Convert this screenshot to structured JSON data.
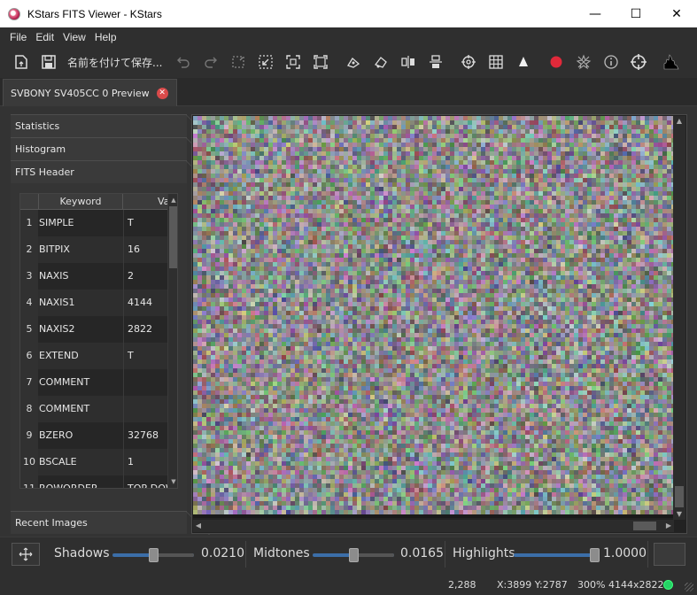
{
  "window": {
    "title": "KStars FITS Viewer - KStars",
    "minimize_glyph": "—",
    "maximize_glyph": "☐",
    "close_glyph": "✕"
  },
  "menu": [
    "File",
    "Edit",
    "View",
    "Help"
  ],
  "toolbar": {
    "save_as_label": "名前を付けて保存...",
    "icons": [
      "open-file-icon",
      "save-icon",
      "undo-icon",
      "redo-icon",
      "crop-icon",
      "zoom-fit-icon",
      "zoom-in-icon",
      "zoom-out-icon",
      "mark-stars-icon",
      "histogram-icon",
      "flip-horizontal-icon",
      "flip-vertical-icon",
      "crosshair-icon",
      "pixel-grid-icon",
      "triangle-icon",
      "record-icon",
      "star-filter-icon",
      "info-icon",
      "target-icon",
      "histogram-chart-icon"
    ]
  },
  "tab": {
    "label": "SVBONY SV405CC 0 Preview",
    "close_glyph": "✕"
  },
  "sidebar": {
    "sections": [
      "Statistics",
      "Histogram",
      "FITS Header"
    ],
    "recent_images": "Recent Images"
  },
  "fits_table": {
    "columns": [
      "Keyword",
      "Value"
    ],
    "rows": [
      {
        "num": "1",
        "keyword": "SIMPLE",
        "value": "T"
      },
      {
        "num": "2",
        "keyword": "BITPIX",
        "value": "16"
      },
      {
        "num": "3",
        "keyword": "NAXIS",
        "value": "2"
      },
      {
        "num": "4",
        "keyword": "NAXIS1",
        "value": "4144"
      },
      {
        "num": "5",
        "keyword": "NAXIS2",
        "value": "2822"
      },
      {
        "num": "6",
        "keyword": "EXTEND",
        "value": "T"
      },
      {
        "num": "7",
        "keyword": "COMMENT",
        "value": ""
      },
      {
        "num": "8",
        "keyword": "COMMENT",
        "value": ""
      },
      {
        "num": "9",
        "keyword": "BZERO",
        "value": "32768"
      },
      {
        "num": "10",
        "keyword": "BSCALE",
        "value": "1"
      },
      {
        "num": "11",
        "keyword": "ROWORDER",
        "value": "TOP-DOWN"
      }
    ]
  },
  "controls": {
    "shadows_label": "Shadows",
    "shadows_value": "0.0210",
    "shadows_fraction": 0.021,
    "midtones_label": "Midtones",
    "midtones_value": "0.0165",
    "midtones_fraction": 0.0165,
    "highlights_label": "Highlights",
    "highlights_value": "1.0000",
    "highlights_fraction": 1.0,
    "center_icon": "move-icon"
  },
  "status": {
    "pixel_value": "2,288",
    "coords": "X:3899 Y:2787",
    "zoom": "300%",
    "size": "4144x2822",
    "indicator_color": "#25d366"
  }
}
